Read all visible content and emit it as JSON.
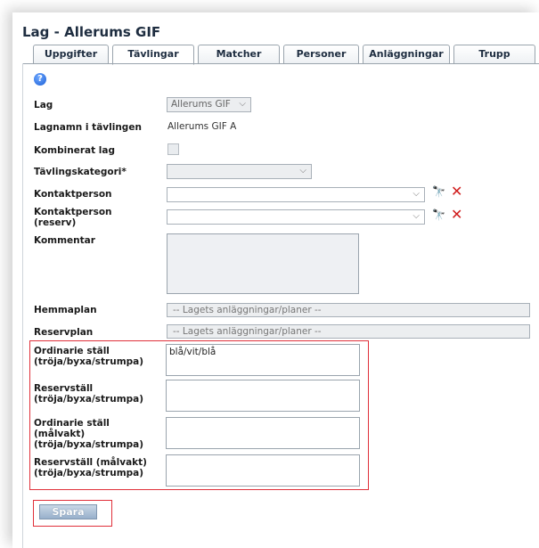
{
  "page": {
    "title": "Lag - Allerums GIF"
  },
  "tabs": [
    {
      "label": "Uppgifter"
    },
    {
      "label": "Tävlingar"
    },
    {
      "label": "Matcher"
    },
    {
      "label": "Personer"
    },
    {
      "label": "Anläggningar"
    },
    {
      "label": "Trupp"
    }
  ],
  "active_tab": "Tävlingar",
  "help": {
    "glyph": "?"
  },
  "form": {
    "lag": {
      "label": "Lag",
      "value": "Allerums GIF"
    },
    "lagnamn": {
      "label": "Lagnamn i tävlingen",
      "value": "Allerums GIF A"
    },
    "kombinerat": {
      "label": "Kombinerat lag"
    },
    "kategori": {
      "label": "Tävlingskategori*",
      "value": ""
    },
    "kontakt": {
      "label": "Kontaktperson",
      "value": ""
    },
    "kontakt_reserv": {
      "label1": "Kontaktperson",
      "label2": "(reserv)",
      "value": ""
    },
    "kommentar": {
      "label": "Kommentar",
      "value": ""
    },
    "hemmaplan": {
      "label": "Hemmaplan",
      "placeholder": "-- Lagets anläggningar/planer --"
    },
    "reservplan": {
      "label": "Reservplan",
      "placeholder": "-- Lagets anläggningar/planer --"
    },
    "ordinarie": {
      "label1": "Ordinarie ställ",
      "label2": "(tröja/byxa/strumpa)",
      "value": "blå/vit/blå"
    },
    "reservstall": {
      "label1": "Reservställ",
      "label2": "(tröja/byxa/strumpa)",
      "value": ""
    },
    "ordinarie_mv": {
      "label1": "Ordinarie ställ",
      "label2": "(målvakt)",
      "label3": "(tröja/byxa/strumpa)",
      "value": ""
    },
    "reserv_mv": {
      "label1": "Reservställ (målvakt)",
      "label2": "(tröja/byxa/strumpa)",
      "value": ""
    }
  },
  "icons": {
    "chevron": "⌵",
    "binoculars": "🔭",
    "close": "✕"
  },
  "save_label": "Spara",
  "colors": {
    "highlight": "#e0303a",
    "accent": "#1e5aa8",
    "delete": "#d01c1c"
  }
}
